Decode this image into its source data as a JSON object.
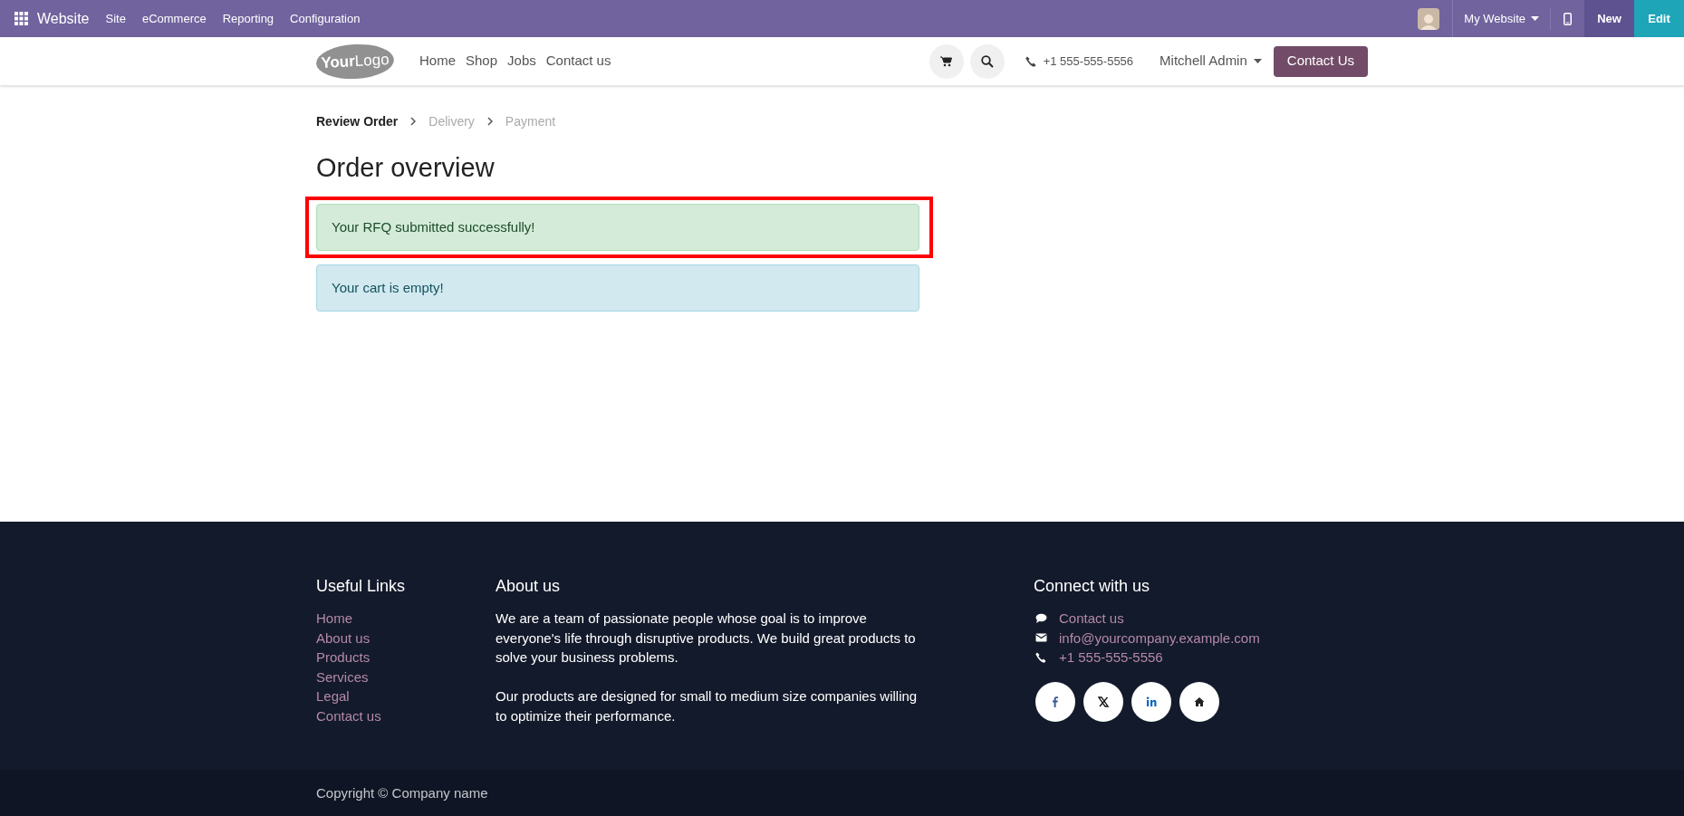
{
  "admin_bar": {
    "app": "Website",
    "menu": [
      "Site",
      "eCommerce",
      "Reporting",
      "Configuration"
    ],
    "website_switcher": "My Website",
    "new_button": "New",
    "edit_button": "Edit"
  },
  "header": {
    "logo": {
      "bold": "Your",
      "light": "Logo"
    },
    "nav": [
      "Home",
      "Shop",
      "Jobs",
      "Contact us"
    ],
    "phone": "+1 555-555-5556",
    "user": "Mitchell Admin",
    "cta": "Contact Us"
  },
  "breadcrumb": [
    {
      "label": "Review Order",
      "selected": true
    },
    {
      "label": "Delivery",
      "selected": false
    },
    {
      "label": "Payment",
      "selected": false
    }
  ],
  "title": "Order overview",
  "alerts": [
    {
      "kind": "success",
      "text": "Your RFQ submitted successfully!",
      "highlighted": true
    },
    {
      "kind": "info",
      "text": "Your cart is empty!",
      "highlighted": false
    }
  ],
  "footer": {
    "useful_links": {
      "title": "Useful Links",
      "links": [
        "Home",
        "About us",
        "Products",
        "Services",
        "Legal",
        "Contact us"
      ]
    },
    "about": {
      "title": "About us",
      "paragraphs": [
        "We are a team of passionate people whose goal is to improve everyone's life through disruptive products. We build great products to solve your business problems.",
        "Our products are designed for small to medium size companies willing to optimize their performance."
      ]
    },
    "connect": {
      "title": "Connect with us",
      "items": [
        {
          "kind": "chat",
          "text": "Contact us"
        },
        {
          "kind": "email",
          "text": "info@yourcompany.example.com"
        },
        {
          "kind": "phone",
          "text": "+1 555-555-5556"
        }
      ],
      "social": [
        {
          "kind": "facebook"
        },
        {
          "kind": "x"
        },
        {
          "kind": "linkedin"
        },
        {
          "kind": "home"
        }
      ]
    },
    "copyright": "Copyright © Company name"
  }
}
